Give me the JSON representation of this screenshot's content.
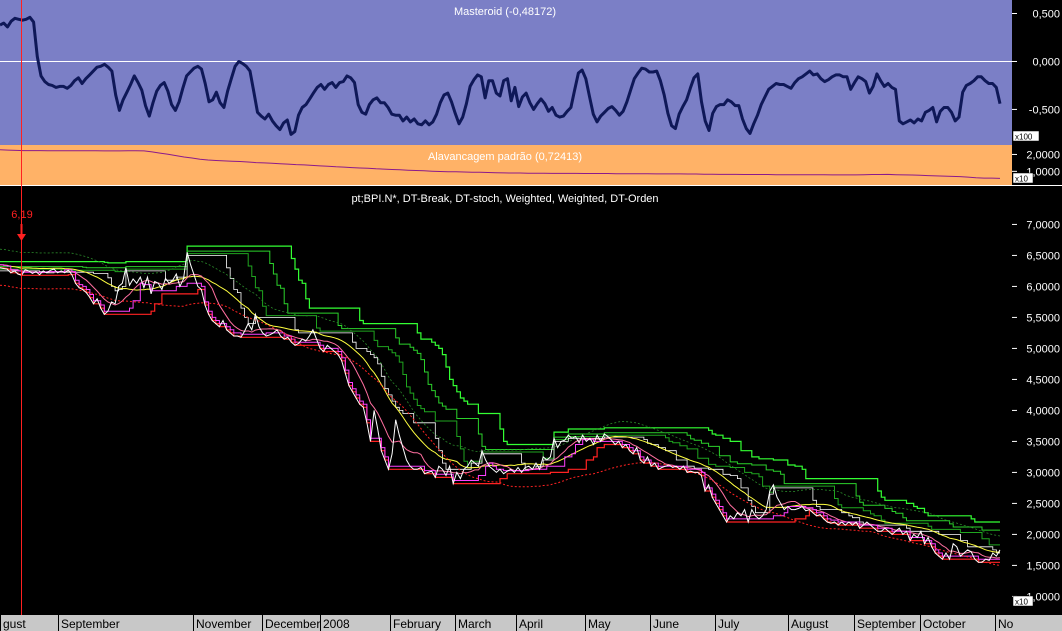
{
  "colors": {
    "panel1_bg": "#7b7fc6",
    "panel1_line": "#0f1858",
    "panel2_bg": "#ffb267",
    "panel2_line": "#8b1a8b",
    "panel3_bg": "#000000",
    "price": "#ffffff",
    "marker": "#ff2020",
    "axis_bg": "#c8c8c8",
    "bright_green": "#33ff33",
    "green": "#2bd22b",
    "yellow": "#ffff40",
    "red": "#ff2222",
    "magenta": "#ff40ff",
    "pink": "#ff6fa0"
  },
  "marker": {
    "label": "6,19"
  },
  "chart_data": [
    {
      "type": "line",
      "title": "Masteroid (-0,48172)",
      "axis_scale_label": "x100",
      "yticks": [
        "0,500",
        "0,000",
        "-0,500"
      ],
      "ylim": [
        -0.85,
        0.62
      ],
      "reference_line": 0,
      "series": [
        {
          "values": [
            0.38,
            0.4,
            0.36,
            0.42,
            0.45,
            0.44,
            0.43,
            0.44,
            0.46,
            0.41,
            0.05,
            -0.15,
            -0.21,
            -0.24,
            -0.25,
            -0.27,
            -0.26,
            -0.26,
            -0.28,
            -0.25,
            -0.2,
            -0.17,
            -0.23,
            -0.18,
            -0.14,
            -0.1,
            -0.06,
            -0.05,
            -0.03,
            -0.06,
            -0.1,
            -0.35,
            -0.51,
            -0.4,
            -0.32,
            -0.24,
            -0.15,
            -0.22,
            -0.3,
            -0.46,
            -0.57,
            -0.43,
            -0.31,
            -0.25,
            -0.22,
            -0.31,
            -0.45,
            -0.51,
            -0.42,
            -0.28,
            -0.15,
            -0.11,
            -0.07,
            -0.05,
            -0.08,
            -0.23,
            -0.42,
            -0.4,
            -0.32,
            -0.43,
            -0.48,
            -0.31,
            -0.18,
            -0.05,
            0.0,
            -0.02,
            -0.05,
            -0.1,
            -0.31,
            -0.53,
            -0.57,
            -0.6,
            -0.55,
            -0.62,
            -0.67,
            -0.71,
            -0.64,
            -0.61,
            -0.76,
            -0.73,
            -0.56,
            -0.48,
            -0.45,
            -0.39,
            -0.33,
            -0.27,
            -0.24,
            -0.29,
            -0.24,
            -0.22,
            -0.27,
            -0.22,
            -0.21,
            -0.15,
            -0.17,
            -0.22,
            -0.45,
            -0.53,
            -0.55,
            -0.45,
            -0.4,
            -0.38,
            -0.43,
            -0.43,
            -0.48,
            -0.55,
            -0.56,
            -0.56,
            -0.62,
            -0.58,
            -0.63,
            -0.6,
            -0.65,
            -0.66,
            -0.62,
            -0.66,
            -0.63,
            -0.55,
            -0.43,
            -0.35,
            -0.33,
            -0.42,
            -0.54,
            -0.65,
            -0.58,
            -0.44,
            -0.26,
            -0.19,
            -0.14,
            -0.16,
            -0.38,
            -0.2,
            -0.2,
            -0.33,
            -0.36,
            -0.2,
            -0.18,
            -0.41,
            -0.27,
            -0.47,
            -0.37,
            -0.33,
            -0.43,
            -0.5,
            -0.44,
            -0.39,
            -0.44,
            -0.52,
            -0.48,
            -0.56,
            -0.58,
            -0.57,
            -0.52,
            -0.48,
            -0.3,
            -0.12,
            -0.09,
            -0.18,
            -0.37,
            -0.55,
            -0.63,
            -0.57,
            -0.53,
            -0.49,
            -0.47,
            -0.51,
            -0.56,
            -0.52,
            -0.42,
            -0.3,
            -0.18,
            -0.12,
            -0.07,
            -0.08,
            -0.11,
            -0.11,
            -0.1,
            -0.2,
            -0.35,
            -0.54,
            -0.67,
            -0.7,
            -0.55,
            -0.47,
            -0.4,
            -0.28,
            -0.17,
            -0.13,
            -0.42,
            -0.62,
            -0.72,
            -0.54,
            -0.47,
            -0.45,
            -0.45,
            -0.4,
            -0.42,
            -0.46,
            -0.46,
            -0.6,
            -0.7,
            -0.75,
            -0.65,
            -0.56,
            -0.45,
            -0.37,
            -0.29,
            -0.26,
            -0.23,
            -0.24,
            -0.24,
            -0.26,
            -0.28,
            -0.22,
            -0.18,
            -0.16,
            -0.13,
            -0.1,
            -0.14,
            -0.13,
            -0.18,
            -0.21,
            -0.19,
            -0.16,
            -0.14,
            -0.14,
            -0.16,
            -0.16,
            -0.29,
            -0.22,
            -0.16,
            -0.18,
            -0.21,
            -0.33,
            -0.26,
            -0.13,
            -0.2,
            -0.26,
            -0.23,
            -0.27,
            -0.29,
            -0.62,
            -0.65,
            -0.63,
            -0.61,
            -0.64,
            -0.6,
            -0.62,
            -0.53,
            -0.51,
            -0.48,
            -0.63,
            -0.52,
            -0.48,
            -0.48,
            -0.53,
            -0.62,
            -0.58,
            -0.32,
            -0.25,
            -0.23,
            -0.2,
            -0.16,
            -0.16,
            -0.2,
            -0.23,
            -0.23,
            -0.27,
            -0.44
          ]
        }
      ]
    },
    {
      "type": "line",
      "title": "Alavancagem padrão (0,72413)",
      "axis_scale_label": "x10",
      "yticks": [
        "2,0000",
        "1,0000"
      ],
      "ylim": [
        0.25,
        2.5
      ],
      "series": [
        {
          "values": [
            2.28,
            2.26,
            2.24,
            2.23,
            2.23,
            2.23,
            2.22,
            2.22,
            2.22,
            2.22,
            2.22,
            2.22,
            2.22,
            2.21,
            2.21,
            2.21,
            2.22,
            2.22,
            2.21,
            2.15,
            2.08,
            2.01,
            1.93,
            1.85,
            1.79,
            1.72,
            1.67,
            1.64,
            1.62,
            1.6,
            1.58,
            1.55,
            1.52,
            1.5,
            1.48,
            1.45,
            1.43,
            1.4,
            1.38,
            1.35,
            1.32,
            1.3,
            1.27,
            1.25,
            1.22,
            1.2,
            1.18,
            1.15,
            1.13,
            1.11,
            1.09,
            1.07,
            1.05,
            1.03,
            1.01,
            0.99,
            0.98,
            0.97,
            0.96,
            0.95,
            0.94,
            0.93,
            0.92,
            0.91,
            0.9,
            0.9,
            0.89,
            0.89,
            0.89,
            0.88,
            0.88,
            0.88,
            0.88,
            0.87,
            0.87,
            0.87,
            0.87,
            0.86,
            0.86,
            0.86,
            0.86,
            0.86,
            0.85,
            0.85,
            0.85,
            0.85,
            0.84,
            0.84,
            0.83,
            0.83,
            0.82,
            0.82,
            0.82,
            0.81,
            0.81,
            0.81,
            0.81,
            0.8,
            0.8,
            0.8,
            0.8,
            0.8,
            0.8,
            0.8,
            0.79,
            0.79,
            0.79,
            0.79,
            0.8,
            0.81,
            0.81,
            0.82,
            0.8,
            0.79,
            0.78,
            0.77,
            0.75,
            0.73,
            0.72,
            0.7,
            0.69,
            0.66,
            0.62,
            0.6,
            0.6,
            0.58
          ]
        }
      ]
    },
    {
      "type": "line",
      "title": "pt;BPI.N*, DT-Break, DT-stoch, Weighted, Weighted, DT-Orden",
      "axis_scale_label": "x10",
      "yticks": [
        "7,0000",
        "6,5000",
        "6,0000",
        "5,5000",
        "5,0000",
        "4,5000",
        "4,0000",
        "3,5000",
        "3,0000",
        "2,5000",
        "2,0000",
        "1,5000",
        "1,0000"
      ],
      "ylim": [
        0.7,
        7.62
      ],
      "xticks": [
        "gust",
        "September",
        "November",
        "December",
        "2008",
        "February",
        "March",
        "April",
        "May",
        "June",
        "July",
        "August",
        "September",
        "October",
        "No"
      ],
      "annotations": [
        "6,19"
      ],
      "series": [
        {
          "values": [
            6.3,
            6.29,
            6.28,
            6.22,
            6.25,
            6.2,
            6.18,
            6.27,
            6.25,
            6.21,
            6.24,
            6.19,
            6.25,
            6.22,
            6.26,
            6.28,
            6.22,
            6.25,
            6.22,
            6.26,
            6.19,
            6.05,
            5.98,
            5.95,
            5.9,
            5.82,
            5.72,
            5.8,
            5.65,
            5.55,
            5.6,
            5.75,
            5.72,
            6.0,
            6.05,
            6.3,
            6.02,
            6.12,
            6.05,
            6.15,
            5.98,
            6.15,
            5.88,
            6.08,
            6.05,
            5.95,
            6.13,
            6.05,
            6.1,
            6.2,
            6.0,
            6.12,
            6.55,
            6.35,
            6.18,
            6.0,
            5.95,
            5.7,
            5.55,
            5.45,
            5.4,
            5.35,
            5.45,
            5.3,
            5.25,
            5.2,
            5.2,
            5.18,
            5.28,
            5.4,
            5.3,
            5.55,
            5.35,
            5.25,
            5.2,
            5.22,
            5.25,
            5.3,
            5.2,
            5.15,
            5.18,
            5.1,
            5.05,
            5.08,
            5.15,
            5.12,
            5.2,
            5.3,
            5.15,
            5.0,
            4.95,
            5.05,
            5.0,
            4.95,
            4.9,
            4.8,
            4.6,
            4.4,
            4.3,
            4.2,
            4.1,
            4.05,
            3.8,
            3.5,
            4.0,
            3.7,
            3.35,
            3.2,
            3.05,
            3.3,
            3.85,
            3.6,
            3.4,
            3.2,
            3.1,
            3.05,
            3.05,
            3.08,
            2.98,
            3.0,
            3.02,
            2.92,
            3.1,
            3.05,
            2.95,
            3.1,
            2.82,
            3.0,
            2.9,
            3.05,
            3.1,
            3.2,
            3.15,
            3.1,
            3.35,
            3.2,
            3.1,
            3.05,
            3.0,
            3.05,
            2.98,
            3.02,
            3.05,
            3.0,
            3.08,
            3.0,
            3.08,
            3.1,
            3.05,
            3.15,
            3.05,
            3.25,
            3.2,
            3.25,
            3.55,
            3.4,
            3.5,
            3.52,
            3.6,
            3.55,
            3.58,
            3.48,
            3.6,
            3.5,
            3.55,
            3.45,
            3.6,
            3.5,
            3.62,
            3.58,
            3.52,
            3.45,
            3.5,
            3.4,
            3.45,
            3.35,
            3.3,
            3.4,
            3.2,
            3.15,
            3.25,
            3.1,
            3.15,
            3.05,
            3.08,
            3.1,
            3.12,
            3.08,
            3.1,
            3.05,
            3.1,
            3.0,
            3.02,
            3.0,
            3.0,
            2.95,
            2.7,
            2.8,
            2.6,
            2.5,
            2.4,
            2.3,
            2.2,
            2.3,
            2.25,
            2.35,
            2.3,
            2.4,
            2.2,
            2.4,
            2.3,
            2.25,
            2.3,
            2.4,
            2.7,
            2.8,
            2.6,
            2.5,
            2.4,
            2.45,
            2.4,
            2.4,
            2.42,
            2.45,
            2.38,
            2.4,
            2.35,
            2.3,
            2.32,
            2.25,
            2.2,
            2.18,
            2.2,
            2.15,
            2.2,
            2.15,
            2.2,
            2.15,
            2.2,
            2.1,
            2.15,
            2.2,
            2.15,
            2.1,
            2.05,
            2.05,
            2.1,
            2.05,
            2.0,
            2.05,
            2.1,
            2.0,
            2.05,
            1.9,
            2.0,
            1.95,
            2.05,
            1.85,
            1.95,
            1.8,
            1.7,
            1.65,
            1.6,
            1.7,
            1.6,
            1.85,
            1.8,
            1.65,
            1.7,
            1.75,
            1.72,
            1.6,
            1.55,
            1.55,
            1.6,
            1.58,
            1.7,
            1.65,
            1.75
          ]
        }
      ]
    }
  ]
}
